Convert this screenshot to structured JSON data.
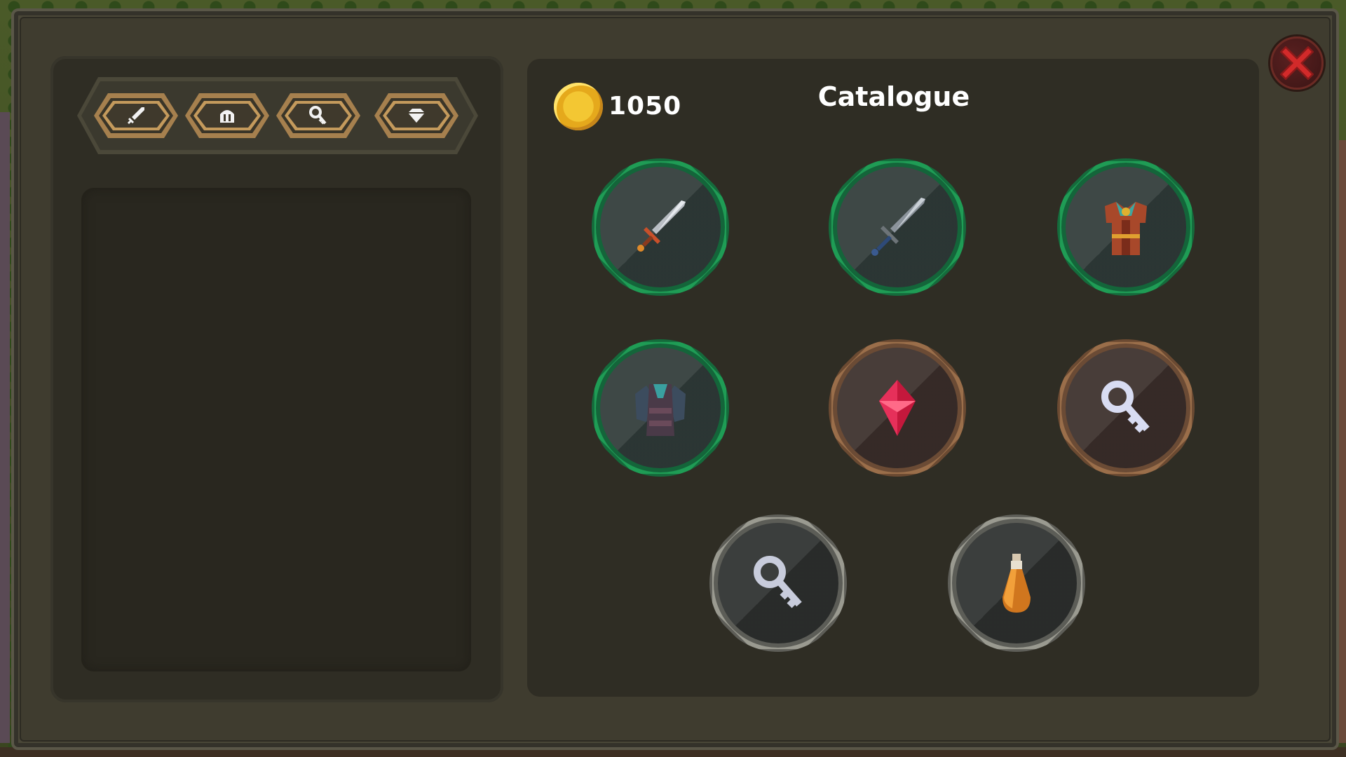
{
  "currency": {
    "amount": "1050",
    "icon": "gold-coin-icon"
  },
  "catalogue": {
    "title": "Catalogue"
  },
  "tabs": [
    {
      "id": "weapons",
      "icon": "sword-icon"
    },
    {
      "id": "armor",
      "icon": "helmet-icon"
    },
    {
      "id": "keys",
      "icon": "key-icon"
    },
    {
      "id": "gems",
      "icon": "diamond-icon"
    }
  ],
  "items": [
    {
      "name": "short-sword",
      "icon": "short-sword-icon",
      "rarity": "green"
    },
    {
      "name": "long-sword",
      "icon": "long-sword-icon",
      "rarity": "green"
    },
    {
      "name": "orange-armor",
      "icon": "orange-armor-icon",
      "rarity": "green"
    },
    {
      "name": "dark-armor",
      "icon": "dark-armor-icon",
      "rarity": "green"
    },
    {
      "name": "red-gem",
      "icon": "red-gem-icon",
      "rarity": "bronze"
    },
    {
      "name": "silver-key",
      "icon": "silver-key-icon",
      "rarity": "bronze"
    },
    {
      "name": "grey-key",
      "icon": "grey-key-icon",
      "rarity": "silver"
    },
    {
      "name": "orange-potion",
      "icon": "orange-potion-icon",
      "rarity": "silver"
    }
  ],
  "colors": {
    "rarity_green": "#1f9c55",
    "rarity_bronze": "#9a6e4a",
    "rarity_silver": "#9a9a90",
    "coin": "#f3c733",
    "close": "#c0282a"
  }
}
